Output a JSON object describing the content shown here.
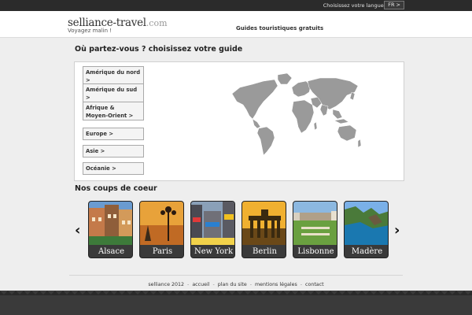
{
  "topbar": {
    "lang_label": "Choisissez votre langue :",
    "lang_value": "FR >"
  },
  "header": {
    "logo_main": "selliance-travel",
    "logo_tld": ".com",
    "tagline": "Voyagez malin !",
    "nav_link": "Guides touristiques gratuits"
  },
  "guide_section": {
    "title": "Où partez-vous ? choisissez votre guide",
    "regions": [
      "Amérique du nord >",
      "Amérique du sud >",
      "Afrique &\n Moyen-Orient >",
      "Europe >",
      "Asie >",
      "Océanie >"
    ]
  },
  "favorites": {
    "title": "Nos coups de coeur",
    "cards": [
      "Alsace",
      "Paris",
      "New York",
      "Berlin",
      "Lisbonne",
      "Madère"
    ]
  },
  "footer": {
    "links": [
      "selliance 2012",
      "accueil",
      "plan du site",
      "mentions légales",
      "contact"
    ]
  },
  "icons": {
    "prev": "chevron-left-icon",
    "next": "chevron-right-icon"
  }
}
